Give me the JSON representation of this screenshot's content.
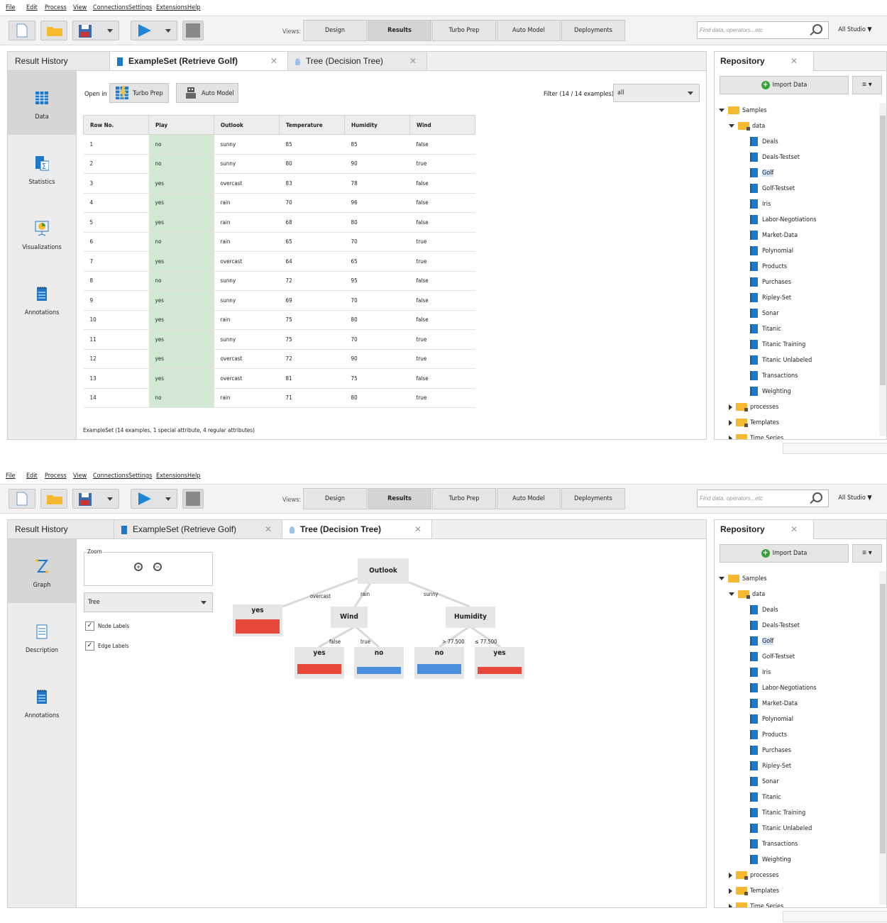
{
  "menu": [
    "File",
    "Edit",
    "Process",
    "View",
    "Connections",
    "Settings",
    "Extensions",
    "Help"
  ],
  "views": {
    "label": "Views:",
    "items": [
      "Design",
      "Results",
      "Turbo Prep",
      "Auto Model",
      "Deployments"
    ],
    "active": "Results"
  },
  "search": {
    "placeholder": "Find data, operators...etc"
  },
  "studio_menu": "All Studio ▼",
  "result_history_tab": "Result History",
  "repository": {
    "title": "Repository",
    "close": "✕",
    "import_button": "Import Data",
    "menu_icon": "≡ ▾",
    "tree": {
      "root": "Samples",
      "data_folder": "data",
      "items": [
        "Deals",
        "Deals-Testset",
        "Golf",
        "Golf-Testset",
        "Iris",
        "Labor-Negotiations",
        "Market-Data",
        "Polynomial",
        "Products",
        "Purchases",
        "Ripley-Set",
        "Sonar",
        "Titanic",
        "Titanic Training",
        "Titanic Unlabeled",
        "Transactions",
        "Weighting"
      ],
      "selected": "Golf",
      "folders": [
        "processes",
        "Templates",
        "Time Series"
      ]
    }
  },
  "screen1": {
    "tabs": [
      {
        "label": "ExampleSet (Retrieve Golf)",
        "close": "✕"
      },
      {
        "label": "Tree (Decision Tree)",
        "close": "✕"
      }
    ],
    "nav": [
      "Data",
      "Statistics",
      "Visualizations",
      "Annotations"
    ],
    "open_in": "Open in",
    "turbo_prep": "Turbo Prep",
    "auto_model": "Auto Model",
    "filter_label": "Filter (14 / 14 examples):",
    "filter_value": "all",
    "table": {
      "headers": [
        "Row No.",
        "Play",
        "Outlook",
        "Temperature",
        "Humidity",
        "Wind"
      ],
      "rows": [
        [
          "1",
          "no",
          "sunny",
          "85",
          "85",
          "false"
        ],
        [
          "2",
          "no",
          "sunny",
          "80",
          "90",
          "true"
        ],
        [
          "3",
          "yes",
          "overcast",
          "83",
          "78",
          "false"
        ],
        [
          "4",
          "yes",
          "rain",
          "70",
          "96",
          "false"
        ],
        [
          "5",
          "yes",
          "rain",
          "68",
          "80",
          "false"
        ],
        [
          "6",
          "no",
          "rain",
          "65",
          "70",
          "true"
        ],
        [
          "7",
          "yes",
          "overcast",
          "64",
          "65",
          "true"
        ],
        [
          "8",
          "no",
          "sunny",
          "72",
          "95",
          "false"
        ],
        [
          "9",
          "yes",
          "sunny",
          "69",
          "70",
          "false"
        ],
        [
          "10",
          "yes",
          "rain",
          "75",
          "80",
          "false"
        ],
        [
          "11",
          "yes",
          "sunny",
          "75",
          "70",
          "true"
        ],
        [
          "12",
          "yes",
          "overcast",
          "72",
          "90",
          "true"
        ],
        [
          "13",
          "yes",
          "overcast",
          "81",
          "75",
          "false"
        ],
        [
          "14",
          "no",
          "rain",
          "71",
          "80",
          "true"
        ]
      ]
    },
    "status": "ExampleSet (14 examples, 1 special attribute, 4 regular attributes)"
  },
  "screen2": {
    "tabs": [
      {
        "label": "ExampleSet (Retrieve Golf)",
        "close": "✕"
      },
      {
        "label": "Tree (Decision Tree)",
        "close": "✕"
      }
    ],
    "nav": [
      "Graph",
      "Description",
      "Annotations"
    ],
    "zoom_label": "Zoom",
    "layout_select": "Tree",
    "node_labels": "Node Labels",
    "edge_labels": "Edge Labels",
    "tree": {
      "root": "Outlook",
      "edges_root": [
        "overcast",
        "rain",
        "sunny"
      ],
      "yes_leaf": "yes",
      "wind": "Wind",
      "humidity": "Humidity",
      "edges_wind": [
        "false",
        "true"
      ],
      "edges_humidity": [
        "> 77.500",
        "≤ 77.500"
      ],
      "leaves": [
        "yes",
        "no",
        "no",
        "yes"
      ]
    }
  },
  "colors": {
    "yes": "#e8473b",
    "no": "#4a8fdc",
    "play_bg": "#d3e8d3",
    "accent": "#1e78c8"
  }
}
